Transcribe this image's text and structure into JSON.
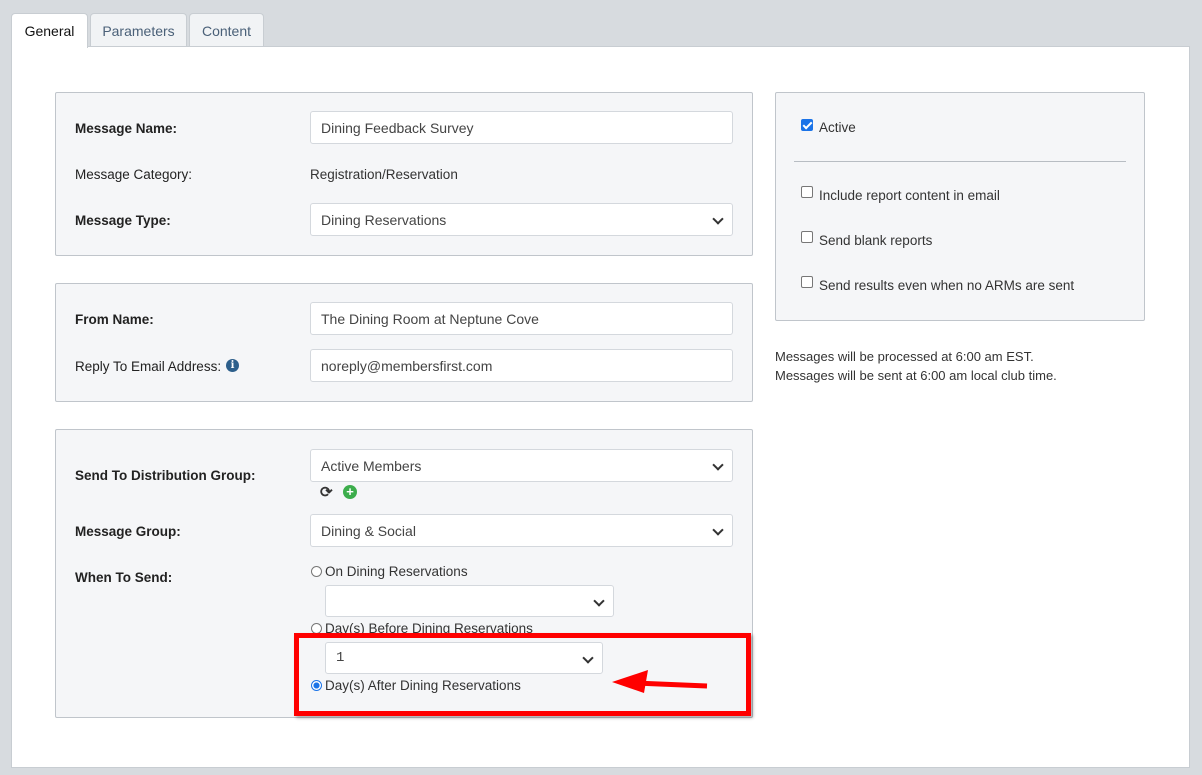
{
  "tabs": [
    {
      "label": "General"
    },
    {
      "label": "Parameters"
    },
    {
      "label": "Content"
    }
  ],
  "message": {
    "name_label": "Message Name:",
    "name_value": "Dining Feedback Survey",
    "category_label": "Message Category:",
    "category_value": "Registration/Reservation",
    "type_label": "Message Type:",
    "type_value": "Dining Reservations"
  },
  "sender": {
    "from_label": "From Name:",
    "from_value": "The Dining Room at Neptune Cove",
    "reply_label": "Reply To Email Address:",
    "reply_value": "noreply@membersfirst.com"
  },
  "sending": {
    "group_label": "Send To Distribution Group:",
    "group_value": "Active Members",
    "msg_group_label": "Message Group:",
    "msg_group_value": "Dining & Social",
    "when_label": "When To Send:",
    "options": [
      {
        "label": "On Dining Reservations",
        "selected": false
      },
      {
        "label": "Day(s) Before Dining Reservations",
        "selected": false
      },
      {
        "label": "Day(s) After Dining Reservations",
        "selected": true
      }
    ],
    "on_select_value": "",
    "days_value": "1"
  },
  "settings": {
    "active_label": "Active",
    "active": true,
    "include_label": "Include report content in email",
    "include": false,
    "blank_label": "Send blank reports",
    "blank": false,
    "results_label": "Send results even when no ARMs are sent",
    "results": false
  },
  "notes": {
    "line1": "Messages will be processed at 6:00 am EST.",
    "line2": "Messages will be sent at 6:00 am local club time."
  },
  "colors": {
    "highlight": "#ff0000",
    "accent": "#1a73e8",
    "add": "#3cad4c"
  }
}
